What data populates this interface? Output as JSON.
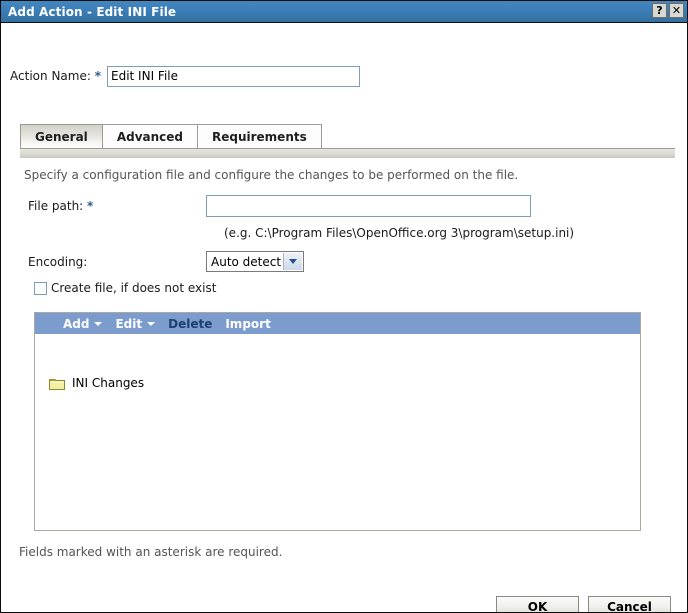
{
  "window": {
    "title": "Add Action - Edit INI File",
    "help_button": "?",
    "close_button": "✕",
    "accent_color": "#3a7cb5",
    "toolbar_color": "#7b9ccd"
  },
  "form": {
    "action_name_label": "Action Name:",
    "action_name_required_marker": "*",
    "action_name_value": "Edit INI File"
  },
  "tabs": [
    {
      "label": "General",
      "active": true
    },
    {
      "label": "Advanced",
      "active": false
    },
    {
      "label": "Requirements",
      "active": false
    }
  ],
  "general": {
    "description": "Specify a configuration file and configure the changes to be performed on the file.",
    "file_path_label": "File path:",
    "file_path_required_marker": "*",
    "file_path_value": "",
    "file_path_hint": "(e.g. C:\\Program Files\\OpenOffice.org 3\\program\\setup.ini)",
    "encoding_label": "Encoding:",
    "encoding_value": "Auto detect",
    "create_file_label": "Create file, if does not exist",
    "create_file_checked": false
  },
  "list_panel": {
    "toolbar": [
      {
        "label": "Add",
        "has_caret": true,
        "enabled": true
      },
      {
        "label": "Edit",
        "has_caret": true,
        "enabled": true
      },
      {
        "label": "Delete",
        "has_caret": false,
        "enabled": false
      },
      {
        "label": "Import",
        "has_caret": false,
        "enabled": true
      }
    ],
    "items": [
      {
        "label": "INI Changes",
        "icon": "folder-icon"
      }
    ]
  },
  "footer": {
    "note": "Fields marked with an asterisk are required.",
    "ok_label": "OK",
    "cancel_label": "Cancel"
  }
}
